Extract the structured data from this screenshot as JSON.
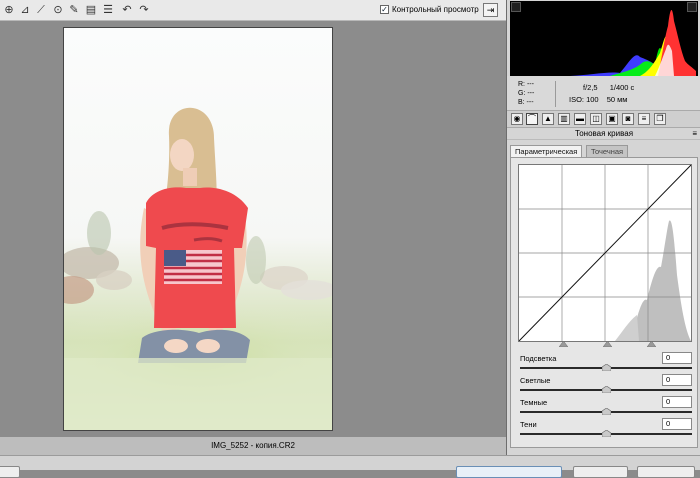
{
  "toolbar": {
    "tools": [
      {
        "name": "zoom-icon",
        "glyph": "⊕"
      },
      {
        "name": "color-sampler-icon",
        "glyph": "⊿"
      },
      {
        "name": "brush-icon",
        "glyph": "⟋"
      },
      {
        "name": "red-eye-icon",
        "glyph": "⊙"
      },
      {
        "name": "adjustment-brush-icon",
        "glyph": "✎"
      },
      {
        "name": "graduated-filter-icon",
        "glyph": "▤"
      },
      {
        "name": "preferences-icon",
        "glyph": "☰"
      },
      {
        "name": "rotate-left-icon",
        "glyph": "↶"
      },
      {
        "name": "rotate-right-icon",
        "glyph": "↷"
      }
    ],
    "preview_label": "Контрольный просмотр",
    "preview_checked": "✓"
  },
  "image": {
    "filename": "IMG_5252 - копия.CR2"
  },
  "info": {
    "r": "R:   ---",
    "g": "G:   ---",
    "b": "B:   ---",
    "aperture": "f/2,5",
    "shutter": "1/400 с",
    "iso": "ISO: 100",
    "focal": "50 мм"
  },
  "panel": {
    "title": "Тоновая кривая",
    "tabs": {
      "parametric": "Параметрическая",
      "point": "Точечная"
    }
  },
  "sliders": [
    {
      "label": "Подсветка",
      "value": "0",
      "level": 0.5
    },
    {
      "label": "Светлые",
      "value": "0",
      "level": 0.5
    },
    {
      "label": "Темные",
      "value": "0",
      "level": 0.5
    },
    {
      "label": "Тени",
      "value": "0",
      "level": 0.5
    }
  ],
  "colors": {
    "histogram_red": "#ff3232",
    "histogram_yellow": "#ffff00",
    "histogram_green": "#00ff00",
    "histogram_blue": "#3f3cff",
    "histogram_luminance": "#cccccc",
    "shirt": "#ef4a4e"
  }
}
